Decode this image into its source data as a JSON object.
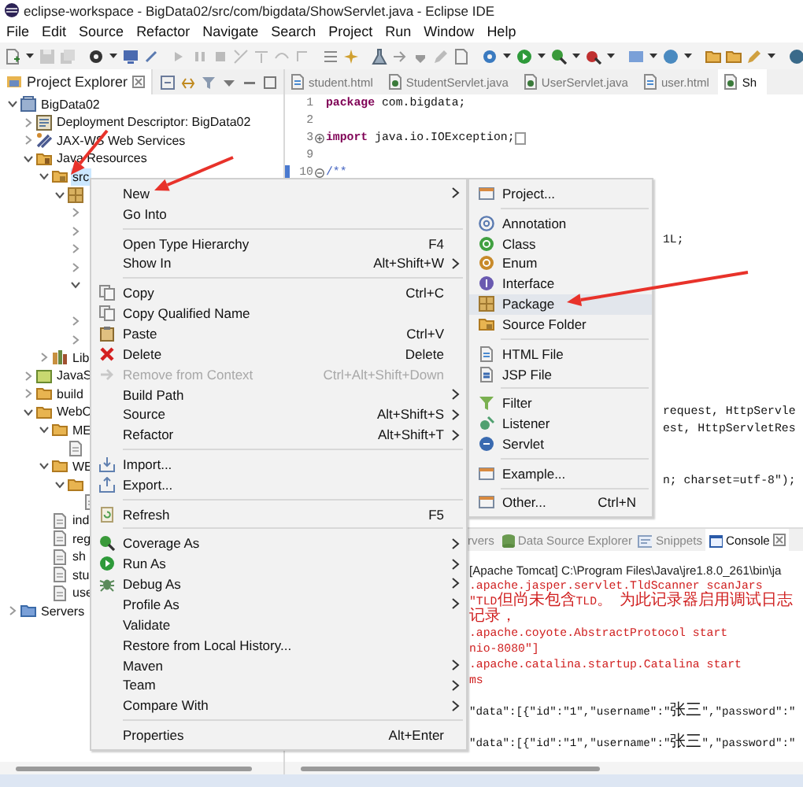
{
  "window": {
    "title": "eclipse-workspace - BigData02/src/com/bigdata/ShowServlet.java - Eclipse IDE"
  },
  "menu_bar": [
    "File",
    "Edit",
    "Source",
    "Refactor",
    "Navigate",
    "Search",
    "Project",
    "Run",
    "Window",
    "Help"
  ],
  "project_explorer": {
    "title": "Project Explorer",
    "tree": [
      {
        "label": "BigData02",
        "kind": "project",
        "expanded": true,
        "selected": false,
        "children": [
          {
            "label": "Deployment Descriptor: BigData02",
            "kind": "descriptor",
            "expanded": false,
            "selected": false
          },
          {
            "label": "JAX-WS Web Services",
            "kind": "webservices",
            "expanded": false,
            "selected": false
          },
          {
            "label": "Java Resources",
            "kind": "java-resources",
            "expanded": true,
            "selected": false,
            "children": [
              {
                "label": "src",
                "kind": "source-folder",
                "expanded": true,
                "selected": true,
                "children": [
                  {
                    "kind": "package",
                    "expanded": true,
                    "selected": false,
                    "children": [
                      {
                        "expanded": false,
                        "selected": false
                      },
                      {
                        "expanded": false,
                        "selected": false
                      },
                      {
                        "expanded": false,
                        "selected": false
                      },
                      {
                        "expanded": false,
                        "selected": false
                      },
                      {
                        "expanded": true,
                        "selected": false,
                        "children": [
                          {
                            "selected": false
                          }
                        ]
                      },
                      {
                        "expanded": false,
                        "selected": false
                      },
                      {
                        "expanded": false,
                        "selected": false
                      }
                    ]
                  }
                ]
              },
              {
                "label": "Lib",
                "kind": "library",
                "expanded": false,
                "selected": false
              }
            ]
          },
          {
            "label": "JavaS",
            "kind": "javascript",
            "expanded": false,
            "selected": false
          },
          {
            "label": "build",
            "kind": "folder",
            "expanded": false,
            "selected": false
          },
          {
            "label": "WebC",
            "kind": "folder",
            "expanded": true,
            "selected": false,
            "children": [
              {
                "label": "ME",
                "kind": "folder",
                "expanded": true,
                "selected": false,
                "children": [
                  {
                    "kind": "file",
                    "selected": false
                  }
                ]
              },
              {
                "label": "WE",
                "kind": "folder",
                "expanded": true,
                "selected": false,
                "children": [
                  {
                    "kind": "folder",
                    "expanded": true,
                    "selected": false,
                    "children": [
                      {
                        "kind": "file",
                        "selected": false
                      }
                    ]
                  }
                ]
              },
              {
                "label": "ind",
                "kind": "file",
                "selected": false
              },
              {
                "label": "reg",
                "kind": "file",
                "selected": false
              },
              {
                "label": "sh",
                "kind": "file",
                "selected": false
              },
              {
                "label": "stu",
                "kind": "file",
                "selected": false
              },
              {
                "label": "use",
                "kind": "file",
                "selected": false
              }
            ]
          }
        ]
      },
      {
        "label": "Servers",
        "kind": "servers",
        "expanded": false,
        "selected": false
      }
    ]
  },
  "editor": {
    "tabs": [
      {
        "label": "student.html",
        "kind": "html",
        "selected": false
      },
      {
        "label": "StudentServlet.java",
        "kind": "java",
        "selected": false
      },
      {
        "label": "UserServlet.java",
        "kind": "java",
        "selected": false
      },
      {
        "label": "user.html",
        "kind": "html",
        "selected": false
      },
      {
        "label": "Sh",
        "kind": "java",
        "selected": true
      }
    ],
    "lines": [
      {
        "number": "1",
        "text": "**package** com.bigdata;",
        "marker": false
      },
      {
        "number": "2",
        "marker": false
      },
      {
        "number": "3",
        "folded": true,
        "text": "**import** java.io.IOException;",
        "marker": false
      },
      {
        "number": "9",
        "marker": false
      },
      {
        "number": "10",
        "folded": false,
        "text": "/**",
        "kind": "comment",
        "marker": true
      }
    ],
    "fragments": [
      "1L;",
      "request, HttpServle",
      "est, HttpServletRes",
      "n; charset=utf-8\");"
    ]
  },
  "console": {
    "tabs": [
      {
        "label": "rvers",
        "selected": false
      },
      {
        "label": "Data Source Explorer",
        "kind": "database",
        "selected": false
      },
      {
        "label": "Snippets",
        "kind": "snippets",
        "selected": false
      },
      {
        "label": "Console",
        "kind": "console",
        "selected": true
      }
    ],
    "lines": [
      {
        "kind": "info",
        "text": "[Apache Tomcat] C:\\Program Files\\Java\\jre1.8.0_261\\bin\\ja"
      },
      {
        "kind": "error",
        "text": ".apache.jasper.servlet.TldScanner scanJars"
      },
      {
        "kind": "error",
        "text": "\"TLD但尚未包含TLD。 为此记录器启用调试日志记录，"
      },
      {
        "kind": "error",
        "text": ".apache.coyote.AbstractProtocol start"
      },
      {
        "kind": "error",
        "text": "nio-8080\"]"
      },
      {
        "kind": "error",
        "text": ".apache.catalina.startup.Catalina start"
      },
      {
        "kind": "error",
        "text": "ms"
      },
      {
        "kind": "output",
        "text": "\"data\":[{\"id\":\"1\",\"username\":\"张三\",\"password\":\""
      },
      {
        "kind": "output",
        "text": "\"data\":[{\"id\":\"1\",\"username\":\"张三\",\"password\":\""
      }
    ]
  },
  "context_menu": {
    "groups": [
      [
        {
          "label": "New",
          "submenu": true,
          "disabled": false
        },
        {
          "label": "Go Into",
          "submenu": false,
          "disabled": false
        }
      ],
      [
        {
          "label": "Open Type Hierarchy",
          "shortcut": "F4",
          "submenu": false,
          "disabled": false
        },
        {
          "label": "Show In",
          "shortcut": "Alt+Shift+W",
          "submenu": true,
          "disabled": false
        }
      ],
      [
        {
          "label": "Copy",
          "kind": "copy",
          "shortcut": "Ctrl+C",
          "submenu": false,
          "disabled": false
        },
        {
          "label": "Copy Qualified Name",
          "kind": "copy",
          "submenu": false,
          "disabled": false
        },
        {
          "label": "Paste",
          "kind": "paste",
          "shortcut": "Ctrl+V",
          "submenu": false,
          "disabled": false
        },
        {
          "label": "Delete",
          "kind": "delete",
          "shortcut": "Delete",
          "submenu": false,
          "disabled": false
        },
        {
          "label": "Remove from Context",
          "kind": "remove",
          "shortcut": "Ctrl+Alt+Shift+Down",
          "submenu": false,
          "disabled": true
        },
        {
          "label": "Build Path",
          "submenu": true,
          "disabled": false
        },
        {
          "label": "Source",
          "shortcut": "Alt+Shift+S",
          "submenu": true,
          "disabled": false
        },
        {
          "label": "Refactor",
          "shortcut": "Alt+Shift+T",
          "submenu": true,
          "disabled": false
        }
      ],
      [
        {
          "label": "Import...",
          "kind": "import",
          "submenu": false,
          "disabled": false
        },
        {
          "label": "Export...",
          "kind": "export",
          "submenu": false,
          "disabled": false
        }
      ],
      [
        {
          "label": "Refresh",
          "kind": "refresh",
          "shortcut": "F5",
          "submenu": false,
          "disabled": false
        }
      ],
      [
        {
          "label": "Coverage As",
          "kind": "coverage",
          "submenu": true,
          "disabled": false
        },
        {
          "label": "Run As",
          "kind": "run",
          "submenu": true,
          "disabled": false
        },
        {
          "label": "Debug As",
          "kind": "debug",
          "submenu": true,
          "disabled": false
        },
        {
          "label": "Profile As",
          "submenu": true,
          "disabled": false
        },
        {
          "label": "Validate",
          "submenu": false,
          "disabled": false
        },
        {
          "label": "Restore from Local History...",
          "submenu": false,
          "disabled": false
        },
        {
          "label": "Maven",
          "submenu": true,
          "disabled": false
        },
        {
          "label": "Team",
          "submenu": true,
          "disabled": false
        },
        {
          "label": "Compare With",
          "submenu": true,
          "disabled": false
        }
      ],
      [
        {
          "label": "Properties",
          "shortcut": "Alt+Enter",
          "submenu": false,
          "disabled": false
        }
      ]
    ]
  },
  "submenu": {
    "groups": [
      [
        {
          "label": "Project...",
          "kind": "window",
          "selected": false
        }
      ],
      [
        {
          "label": "Annotation",
          "kind": "annotation",
          "selected": false
        },
        {
          "label": "Class",
          "kind": "class",
          "selected": false
        },
        {
          "label": "Enum",
          "kind": "enum",
          "selected": false
        },
        {
          "label": "Interface",
          "kind": "interface",
          "selected": false
        },
        {
          "label": "Package",
          "kind": "package",
          "selected": true
        },
        {
          "label": "Source Folder",
          "kind": "source-folder",
          "selected": false
        }
      ],
      [
        {
          "label": "HTML File",
          "kind": "html-file",
          "selected": false
        },
        {
          "label": "JSP File",
          "kind": "jsp-file",
          "selected": false
        }
      ],
      [
        {
          "label": "Filter",
          "kind": "filter",
          "selected": false
        },
        {
          "label": "Listener",
          "kind": "listener",
          "selected": false
        },
        {
          "label": "Servlet",
          "kind": "servlet",
          "selected": false
        }
      ],
      [
        {
          "label": "Example...",
          "kind": "window",
          "selected": false
        }
      ],
      [
        {
          "label": "Other...",
          "kind": "window",
          "shortcut": "Ctrl+N",
          "selected": false
        }
      ]
    ]
  }
}
